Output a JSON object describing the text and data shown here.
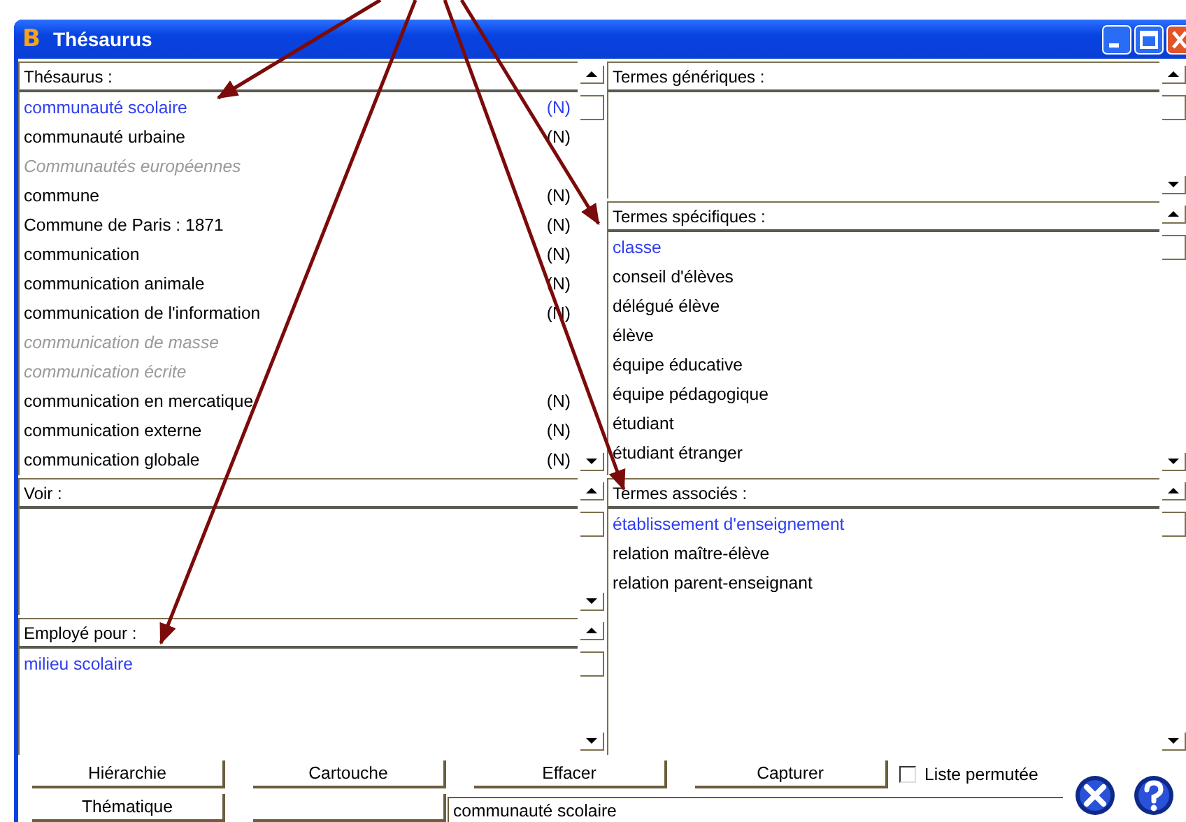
{
  "window": {
    "logo": "B",
    "title": "Thésaurus"
  },
  "left_panels": [
    {
      "kind": "thesaurus",
      "header": "Thésaurus  :",
      "items": [
        {
          "label": "communauté scolaire",
          "tag": "(N)",
          "kind": "descriptor",
          "selected": true
        },
        {
          "label": "communauté urbaine",
          "tag": "(N)",
          "kind": "descriptor",
          "selected": false
        },
        {
          "label": "Communautés européennes",
          "kind": "non_descriptor",
          "selected": false
        },
        {
          "label": "commune",
          "tag": "(N)",
          "kind": "descriptor",
          "selected": false
        },
        {
          "label": "Commune de Paris : 1871",
          "tag": "(N)",
          "kind": "descriptor",
          "selected": false
        },
        {
          "label": "communication",
          "tag": "(N)",
          "kind": "descriptor",
          "selected": false
        },
        {
          "label": "communication animale",
          "tag": "(N)",
          "kind": "descriptor",
          "selected": false
        },
        {
          "label": "communication de l'information",
          "tag": "(N)",
          "kind": "descriptor",
          "selected": false
        },
        {
          "label": "communication de masse",
          "kind": "non_descriptor",
          "selected": false
        },
        {
          "label": "communication écrite",
          "kind": "non_descriptor",
          "selected": false
        },
        {
          "label": "communication en mercatique",
          "tag": "(N)",
          "kind": "descriptor",
          "selected": false
        },
        {
          "label": "communication externe",
          "tag": "(N)",
          "kind": "descriptor",
          "selected": false
        },
        {
          "label": "communication globale",
          "tag": "(N)",
          "kind": "descriptor",
          "selected": false
        }
      ]
    },
    {
      "kind": "small",
      "header": "Voir :"
    },
    {
      "kind": "small",
      "header": "Employé pour :",
      "items": [
        {
          "label": "milieu scolaire",
          "kind": "descriptor",
          "selected": true
        }
      ]
    }
  ],
  "right_panels": [
    {
      "kind": "small",
      "header": "Termes génériques :"
    },
    {
      "kind": "medium",
      "header": "Termes spécifiques :",
      "items": [
        {
          "label": "classe",
          "kind": "descriptor",
          "selected": true
        },
        {
          "label": "conseil d'élèves",
          "kind": "descriptor",
          "selected": false
        },
        {
          "label": "délégué élève",
          "kind": "descriptor",
          "selected": false
        },
        {
          "label": "élève",
          "kind": "descriptor",
          "selected": false
        },
        {
          "label": "équipe éducative",
          "kind": "descriptor",
          "selected": false
        },
        {
          "label": "équipe pédagogique",
          "kind": "descriptor",
          "selected": false
        },
        {
          "label": "étudiant",
          "kind": "descriptor",
          "selected": false
        },
        {
          "label": "étudiant étranger",
          "kind": "descriptor",
          "selected": false
        }
      ]
    },
    {
      "kind": "large",
      "header": "Termes associés :",
      "items": [
        {
          "label": "établissement d'enseignement",
          "kind": "descriptor",
          "selected": true
        },
        {
          "label": "relation maître-élève",
          "kind": "descriptor",
          "selected": false
        },
        {
          "label": "relation parent-enseignant",
          "kind": "descriptor",
          "selected": false
        }
      ]
    }
  ],
  "buttons": [
    "Hiérarchie",
    "Cartouche",
    "Effacer",
    "Capturer",
    "Thématique"
  ],
  "permuted_list": {
    "label": "Liste permutée",
    "checked": false
  },
  "term_field": {
    "value": "communauté scolaire"
  }
}
